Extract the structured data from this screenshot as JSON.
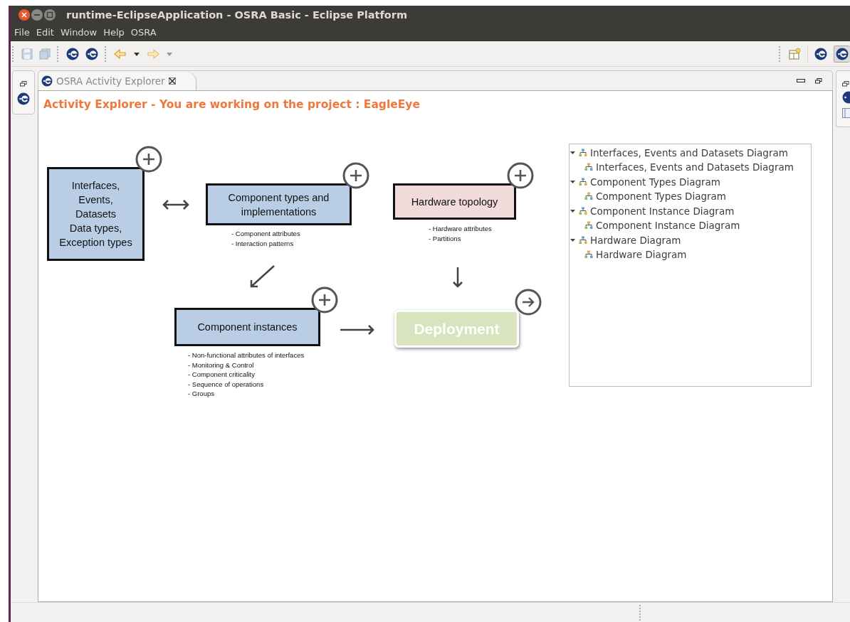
{
  "window": {
    "title": "runtime-EclipseApplication - OSRA Basic - Eclipse Platform"
  },
  "menu": [
    "File",
    "Edit",
    "Window",
    "Help",
    "OSRA"
  ],
  "editor_tab": {
    "label": "OSRA Activity Explorer"
  },
  "heading": "Activity Explorer - You are working on the project : EagleEye",
  "diagram": {
    "nodes": [
      {
        "kind": "box",
        "lines": [
          "Interfaces,",
          "Events,",
          "Datasets",
          "Data types,",
          "Exception types"
        ],
        "color": "#b9cde5",
        "disabled": false
      },
      {
        "kind": "box",
        "lines": [
          "Component types and",
          "implementations"
        ],
        "color": "#b9cde5",
        "disabled": false,
        "notes": [
          "- Component attributes",
          "- Interaction patterns"
        ]
      },
      {
        "kind": "box",
        "lines": [
          "Hardware topology"
        ],
        "color": "#f2dcdb",
        "disabled": false,
        "notes": [
          "- Hardware attributes",
          "- Partitions"
        ]
      },
      {
        "kind": "box",
        "lines": [
          "Component instances"
        ],
        "color": "#b9cde5",
        "disabled": false,
        "notes": [
          "- Non-functional attributes of interfaces",
          "- Monitoring & Control",
          "- Component criticality",
          "- Sequence of operations",
          "- Groups"
        ]
      },
      {
        "kind": "goal",
        "lines": [
          "Deployment"
        ],
        "color": "#d7e4bd",
        "disabled": true
      }
    ]
  },
  "tree": [
    {
      "label": "Interfaces, Events and Datasets Diagram",
      "expanded": true,
      "children": [
        {
          "label": "Interfaces, Events and Datasets Diagram"
        }
      ]
    },
    {
      "label": "Component Types Diagram",
      "expanded": true,
      "children": [
        {
          "label": "Component Types Diagram"
        }
      ]
    },
    {
      "label": "Component Instance Diagram",
      "expanded": true,
      "children": [
        {
          "label": "Component Instance Diagram"
        }
      ]
    },
    {
      "label": "Hardware Diagram",
      "expanded": true,
      "children": [
        {
          "label": "Hardware Diagram"
        }
      ]
    }
  ]
}
